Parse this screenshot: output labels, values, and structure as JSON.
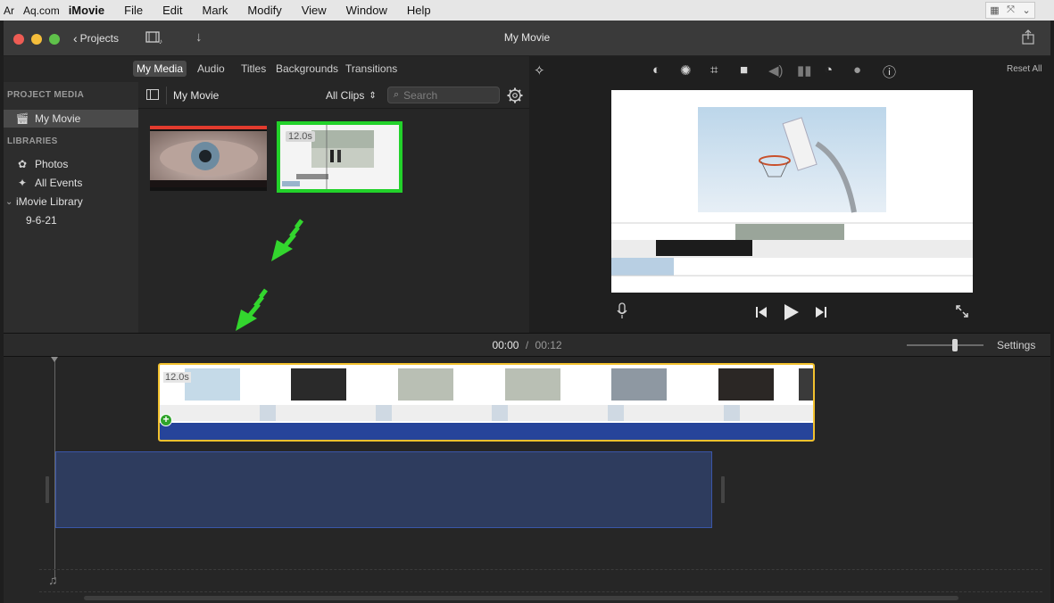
{
  "menubar": {
    "logo_text": "Ar   Aq.com",
    "app_name": "iMovie",
    "items": [
      "File",
      "Edit",
      "Mark",
      "Modify",
      "View",
      "Window",
      "Help"
    ]
  },
  "window": {
    "title": "My Movie",
    "projects_label": "Projects"
  },
  "browser": {
    "tabs": [
      "My Media",
      "Audio",
      "Titles",
      "Backgrounds",
      "Transitions"
    ],
    "selected_tab": "My Media",
    "library_title": "My Movie",
    "filter_value": "All Clips",
    "search_placeholder": "Search",
    "clip_duration": "12.0s"
  },
  "sidebar": {
    "project_media_header": "PROJECT MEDIA",
    "project_item": "My Movie",
    "libraries_header": "LIBRARIES",
    "photos": "Photos",
    "all_events": "All Events",
    "library": "iMovie Library",
    "event": "9-6-21"
  },
  "viewer": {
    "reset_all": "Reset All"
  },
  "timebar": {
    "current_time": "00:00",
    "separator": "/",
    "total_time": "00:12",
    "settings_label": "Settings"
  },
  "timeline": {
    "clip_duration": "12.0s"
  },
  "colors": {
    "selection_green": "#22d12a",
    "clip_yellow": "#f2c12e",
    "audio_blue": "#26449a",
    "drop_zone_blue": "#2e3c5e",
    "accent_red": "#e23b2e"
  },
  "icons": {
    "magic_wand": "magic-wand-icon",
    "color_balance": "color-balance-icon",
    "color_correction": "palette-icon",
    "crop": "crop-icon",
    "stabilization": "camera-icon",
    "volume": "volume-icon",
    "noise": "equalizer-icon",
    "speed": "speed-icon",
    "filter": "filter-icon",
    "info": "info-icon"
  }
}
